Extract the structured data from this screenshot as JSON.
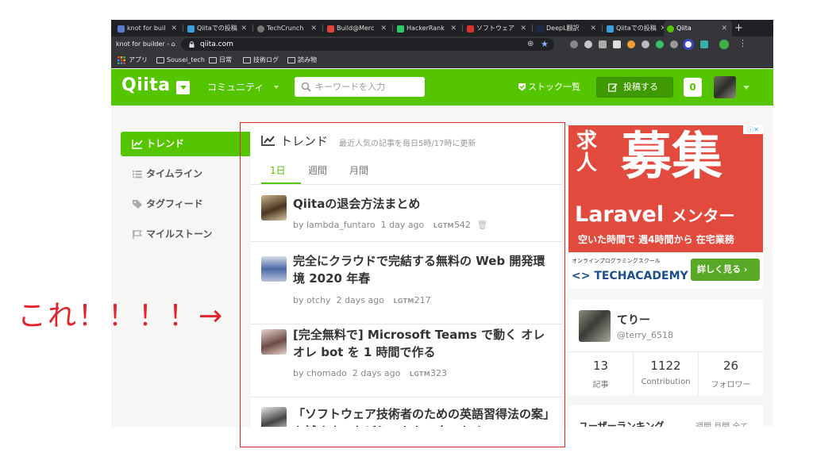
{
  "browser": {
    "tabs": [
      {
        "label": "knot for buil",
        "color": "#5e7bc9"
      },
      {
        "label": "Qiitaでの投稿",
        "color": "#3aa0d8"
      },
      {
        "label": "TechCrunch",
        "color": "#777777"
      },
      {
        "label": "Build@Merc",
        "color": "#e0433a"
      },
      {
        "label": "HackerRank",
        "color": "#2ec866"
      },
      {
        "label": "ソフトウェア",
        "color": "#d9332b"
      },
      {
        "label": "DeepL翻訳",
        "color": "#1a2a4a"
      },
      {
        "label": "Qiitaでの投稿",
        "color": "#3aa0d8"
      },
      {
        "label": "Qiita",
        "color": "#55c500"
      }
    ],
    "new_tab": "+",
    "back_label": "knot for builder -",
    "url": "qiita.com",
    "bookmarks": [
      "アプリ",
      "Sousei_tech",
      "日常",
      "技術ログ",
      "読み物"
    ]
  },
  "header": {
    "logo": "Qiita",
    "community": "コミュニティ",
    "search_placeholder": "キーワードを入力",
    "stock": "ストック一覧",
    "post_button": "投稿する",
    "notification_count": "0"
  },
  "sidebar": {
    "items": [
      {
        "label": "トレンド",
        "icon": "trend-icon"
      },
      {
        "label": "タイムライン",
        "icon": "list-icon"
      },
      {
        "label": "タグフィード",
        "icon": "tag-icon"
      },
      {
        "label": "マイルストーン",
        "icon": "flag-icon"
      }
    ]
  },
  "main": {
    "title": "トレンド",
    "subtitle": "最近人気の記事を毎日5時/17時に更新",
    "period_tabs": [
      "1日",
      "週間",
      "月間"
    ],
    "articles": [
      {
        "title": "Qiitaの退会方法まとめ",
        "by": "by lambda_funtaro",
        "time": "1 day ago",
        "lgtm_label": "LGTM",
        "lgtm": "542"
      },
      {
        "title": "完全にクラウドで完結する無料の Web 開発環境 2020 年春",
        "by": "by otchy",
        "time": "2 days ago",
        "lgtm_label": "LGTM",
        "lgtm": "217"
      },
      {
        "title": "[完全無料で] Microsoft Teams で動く オレオレ bot を 1 時間で作る",
        "by": "by chomado",
        "time": "2 days ago",
        "lgtm_label": "LGTM",
        "lgtm": "323"
      },
      {
        "title": "「ソフトウェア技術者のための英語習得法の案」を試すまでたどりつかない人のため"
      }
    ]
  },
  "ad": {
    "big1": "求人",
    "big2": "募集",
    "laravel": "Laravel",
    "laravel_suffix": "メンター",
    "line3": "空いた時間で 週4時間から 在宅業務",
    "school": "オンラインプログラミングスクール",
    "brand": "<> TECHACADEMY",
    "cta": "詳しく見る ›",
    "close": "ⓘ✕"
  },
  "profile": {
    "name": "てりー",
    "id": "@terry_6518",
    "stats": [
      {
        "num": "13",
        "label": "記事"
      },
      {
        "num": "1122",
        "label": "Contribution"
      },
      {
        "num": "26",
        "label": "フォロワー"
      }
    ]
  },
  "ranking": {
    "title": "ユーザーランキング",
    "tabs": "週間 月間 全て"
  },
  "annotation": "これ！！！！→"
}
